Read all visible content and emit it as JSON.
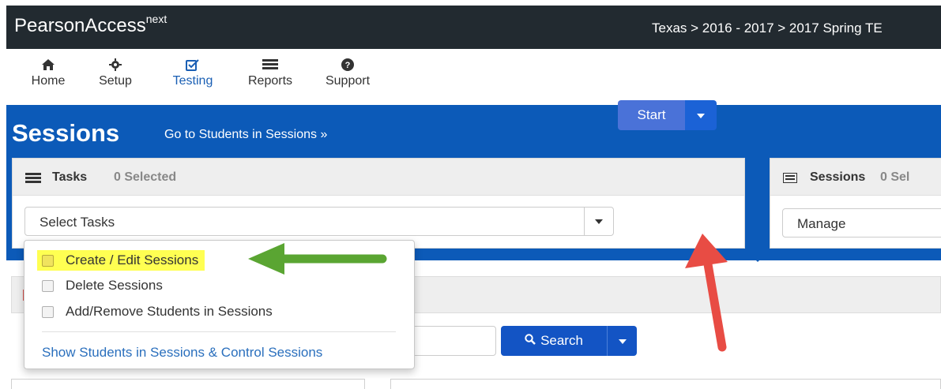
{
  "header": {
    "brand": "PearsonAccess",
    "brand_sup": "next",
    "breadcrumb": "Texas > 2016 - 2017 > 2017 Spring TE"
  },
  "nav": {
    "items": [
      {
        "label": "Home",
        "icon": "home-icon"
      },
      {
        "label": "Setup",
        "icon": "gear-icon"
      },
      {
        "label": "Testing",
        "icon": "checkbox-icon"
      },
      {
        "label": "Reports",
        "icon": "report-icon"
      },
      {
        "label": "Support",
        "icon": "question-icon"
      }
    ],
    "active": "Testing"
  },
  "page": {
    "title": "Sessions",
    "link": "Go to Students in Sessions »"
  },
  "tasks_panel": {
    "title": "Tasks",
    "count": "0 Selected",
    "select_value": "Select Tasks",
    "start_label": "Start"
  },
  "sessions_panel": {
    "title": "Sessions",
    "count": "0 Sel",
    "select_value": "Manage"
  },
  "dropdown": {
    "items": [
      {
        "label": "Create / Edit Sessions",
        "highlighted": true
      },
      {
        "label": "Delete Sessions",
        "highlighted": false
      },
      {
        "label": "Add/Remove Students in Sessions",
        "highlighted": false
      }
    ],
    "footer_link": "Show Students in Sessions & Control Sessions"
  },
  "search": {
    "button_label": "Search"
  },
  "colors": {
    "topbar": "#222a30",
    "band": "#0c5ab8",
    "start": "#4a72d8",
    "highlight": "#ffff52",
    "green_arrow": "#5aa532",
    "red_arrow": "#e84c44"
  }
}
